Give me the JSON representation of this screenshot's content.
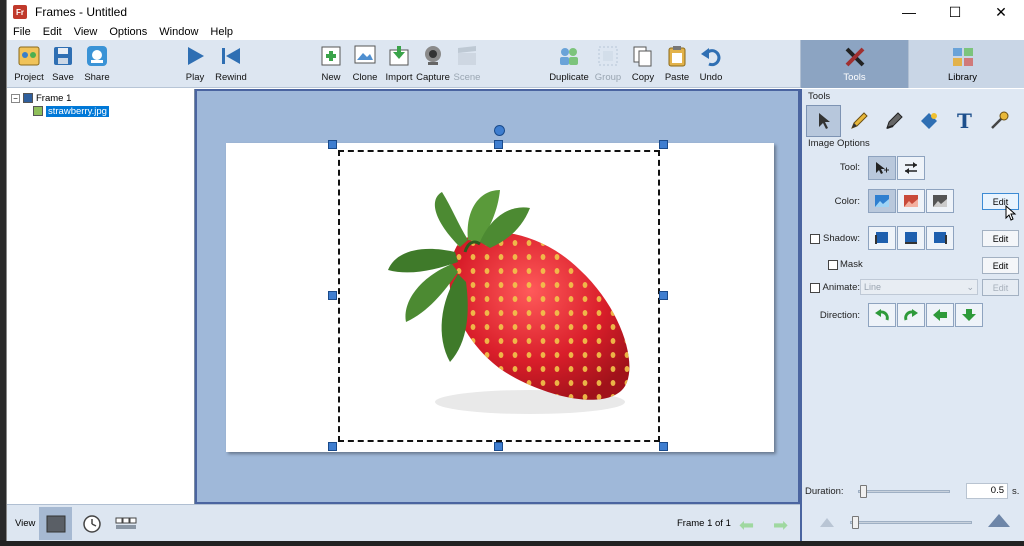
{
  "window": {
    "title": "Frames - Untitled",
    "app_icon": "Fr"
  },
  "window_controls": {
    "minimize": "—",
    "maximize": "☐",
    "close": "✕"
  },
  "menu": [
    "File",
    "Edit",
    "View",
    "Options",
    "Window",
    "Help"
  ],
  "toolbar": {
    "project": "Project",
    "save": "Save",
    "share": "Share",
    "play": "Play",
    "rewind": "Rewind",
    "new": "New",
    "clone": "Clone",
    "import": "Import",
    "capture": "Capture",
    "scene": "Scene",
    "duplicate": "Duplicate",
    "group": "Group",
    "copy": "Copy",
    "paste": "Paste",
    "undo": "Undo"
  },
  "side_tabs": {
    "tools": "Tools",
    "library": "Library"
  },
  "tree": {
    "expander": "−",
    "frame": "Frame 1",
    "item": "strawberry.jpg"
  },
  "bottom": {
    "view_label": "View",
    "frame_count": "Frame 1 of 1"
  },
  "panel": {
    "tools_title": "Tools",
    "image_options_title": "Image Options",
    "tool_label": "Tool:",
    "color_label": "Color:",
    "shadow_label": "Shadow:",
    "mask_label": "Mask",
    "animate_label": "Animate:",
    "direction_label": "Direction:",
    "edit": "Edit",
    "animate_combo": "Line",
    "duration_label": "Duration:",
    "duration_value": "0.5",
    "duration_unit": "s."
  },
  "colors": {
    "accent": "#4a64a0",
    "canvas": "#9fb8d9",
    "toolbar": "#dde6f1",
    "selection": "#0078d7"
  }
}
